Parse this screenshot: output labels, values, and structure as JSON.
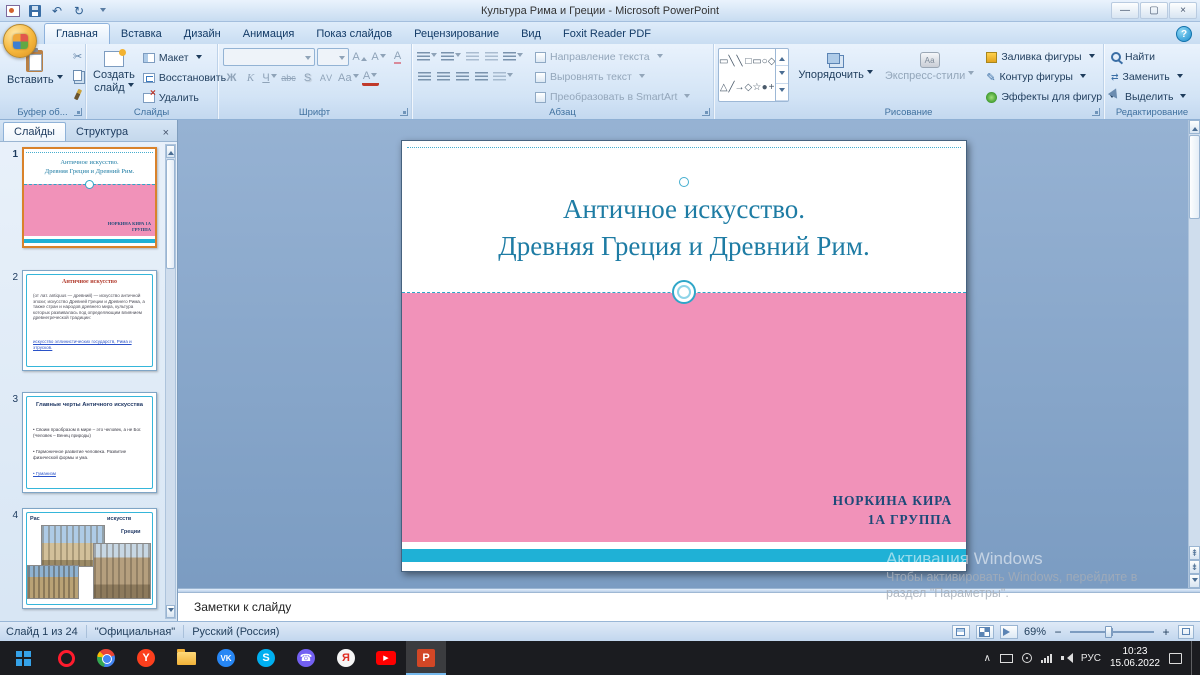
{
  "colors": {
    "slide_pink": "#f192b9",
    "slide_cyan": "#1fb1d6",
    "slide_title_teal": "#1e7ca4",
    "author_navy": "#1d4a78",
    "selected_thumb_border": "#d9822b",
    "taskbar_bg": "#1b1c20"
  },
  "icons": {
    "undo": "↶",
    "redo": "↻",
    "minimize": "—",
    "maximize": "▢",
    "close": "×",
    "help": "?",
    "scissors": "✂",
    "pencil": "✎",
    "phone": "☎",
    "play": "▶",
    "caret": "∧",
    "swap": "⇄",
    "page_up": "⇞",
    "page_down": "⇟",
    "x_small": "×",
    "quick_styles_sample": "Аа"
  },
  "titlebar": {
    "title": "Культура Рима и Греции  -  Microsoft PowerPoint"
  },
  "tabs": {
    "items": [
      "Главная",
      "Вставка",
      "Дизайн",
      "Анимация",
      "Показ слайдов",
      "Рецензирование",
      "Вид",
      "Foxit Reader PDF"
    ]
  },
  "ribbon": {
    "clipboard": {
      "label": "Буфер об...",
      "paste": "Вставить"
    },
    "slides": {
      "label": "Слайды",
      "new_slide": "Создать слайд",
      "layout": "Макет",
      "reset": "Восстановить",
      "del": "Удалить"
    },
    "font": {
      "label": "Шрифт",
      "grow": "А",
      "shrink": "А",
      "clear": "А",
      "bold": "Ж",
      "italic": "К",
      "underline": "Ч",
      "strike": "abc",
      "shadow": "S",
      "spacing": "AV",
      "case_btn": "Аа",
      "color_btn": "А"
    },
    "paragraph": {
      "label": "Абзац",
      "text_direction": "Направление текста",
      "align_text": "Выровнять текст",
      "smartart": "Преобразовать в SmartArt"
    },
    "drawing": {
      "label": "Рисование",
      "arrange": "Упорядочить",
      "quick_styles": "Экспресс-стили",
      "fill": "Заливка фигуры",
      "outline": "Контур фигуры",
      "effects": "Эффекты для фигур",
      "shapes_row1": [
        "▭",
        "╲",
        "╲",
        "□",
        "▭",
        "○",
        "◇"
      ],
      "shapes_row2": [
        "△",
        "╱",
        "→",
        "◇",
        "☆",
        "●",
        "+"
      ]
    },
    "editing": {
      "label": "Редактирование",
      "find": "Найти",
      "replace": "Заменить",
      "select": "Выделить"
    }
  },
  "panel": {
    "tab_slides": "Слайды",
    "tab_outline": "Структура",
    "thumbs": [
      {
        "n": "1",
        "title1": "Античное искусство.",
        "title2": "Древняя Греция и Древний Рим.",
        "author": "НОРКИНА КИРА 1А ГРУППА"
      },
      {
        "n": "2",
        "title": "Античное искусство",
        "body": "(от лат. antiquus — древний) — искусство античной эпохи; искусство Древней Греции и Древнего Рима, а также стран и народов древнего мира, культура которых развивалась под определяющим влиянием древнегреческой традиции:",
        "links": "искусство эллинистических государств, Рима и этрусков."
      },
      {
        "n": "3",
        "title": "Главные черты Античного искусства",
        "b1": "• Своим праобразом в мире – это человек, а не Бог. (Человек – Венец природы)",
        "b2": "• Гармоничное развитие человека. Развитие физической формы и ума.",
        "b3": "• Гуманизм"
      },
      {
        "n": "4",
        "t1": "Рас",
        "t2": "искусств",
        "t3": "Греции"
      }
    ]
  },
  "slide": {
    "title1": "Античное искусство.",
    "title2": "Древняя Греция и Древний Рим.",
    "author1": "НОРКИНА КИРА",
    "author2": "1А ГРУППА"
  },
  "notes": {
    "placeholder": "Заметки к слайду"
  },
  "statusbar": {
    "slide_info": "Слайд 1 из 24",
    "theme": "\"Официальная\"",
    "lang": "Русский (Россия)",
    "zoom": "69%",
    "zoom_minus": "−",
    "zoom_plus": "+"
  },
  "taskbar": {
    "lang": "РУС",
    "time": "10:23",
    "date": "15.06.2022",
    "letters": {
      "yandex": "Y",
      "vk": "VK",
      "skype": "S",
      "yandex_browser": "Я",
      "youtube_play": "▶",
      "powerpoint": "P"
    }
  },
  "watermark": {
    "l1": "Активация Windows",
    "l2": "Чтобы активировать Windows, перейдите в",
    "l3": "раздел \"Параметры\"."
  }
}
